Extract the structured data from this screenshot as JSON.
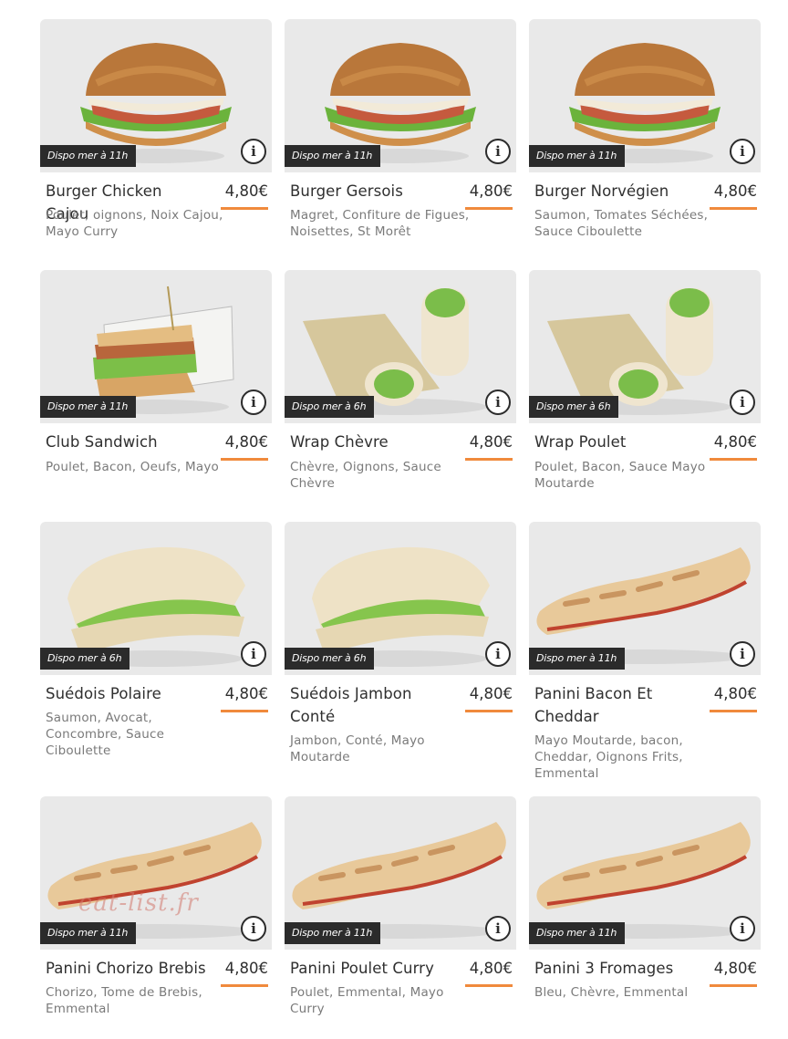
{
  "products": [
    {
      "name": "Burger Chicken Cajou",
      "price": "4,80€",
      "availability": "Dispo mer à 11h",
      "description": "Poulet, oignons, Noix Cajou, Mayo Curry",
      "image": "burger-image"
    },
    {
      "name": "Burger Gersois",
      "price": "4,80€",
      "availability": "Dispo mer à 11h",
      "description": "Magret, Confiture de Figues, Noisettes, St Morêt",
      "image": "burger-image"
    },
    {
      "name": "Burger Norvégien",
      "price": "4,80€",
      "availability": "Dispo mer à 11h",
      "description": "Saumon, Tomates Séchées, Sauce Ciboulette",
      "image": "burger-image"
    },
    {
      "name": "Club Sandwich",
      "price": "4,80€",
      "availability": "Dispo mer à 11h",
      "description": "Poulet, Bacon, Oeufs, Mayo",
      "image": "club-sandwich-image"
    },
    {
      "name": "Wrap Chèvre",
      "price": "4,80€",
      "availability": "Dispo mer à 6h",
      "description": "Chèvre, Oignons, Sauce Chèvre",
      "image": "wrap-image"
    },
    {
      "name": "Wrap Poulet",
      "price": "4,80€",
      "availability": "Dispo mer à 6h",
      "description": "Poulet, Bacon, Sauce Mayo Moutarde",
      "image": "wrap-image"
    },
    {
      "name": "Suédois Polaire",
      "price": "4,80€",
      "availability": "Dispo mer à 6h",
      "description": "Saumon, Avocat, Concombre, Sauce Ciboulette",
      "image": "pita-image"
    },
    {
      "name": "Suédois Jambon Conté",
      "price": "4,80€",
      "availability": "Dispo mer à 6h",
      "description": "Jambon, Conté, Mayo Moutarde",
      "image": "pita-image"
    },
    {
      "name": "Panini Bacon Et Cheddar",
      "price": "4,80€",
      "availability": "Dispo mer à 11h",
      "description": "Mayo Moutarde, bacon, Cheddar, Oignons Frits, Emmental",
      "image": "panini-image"
    },
    {
      "name": "Panini Chorizo Brebis",
      "price": "4,80€",
      "availability": "Dispo mer à 11h",
      "description": "Chorizo, Tome de Brebis, Emmental",
      "image": "panini-image"
    },
    {
      "name": "Panini Poulet Curry",
      "price": "4,80€",
      "availability": "Dispo mer à 11h",
      "description": "Poulet, Emmental, Mayo Curry",
      "image": "panini-image"
    },
    {
      "name": "Panini 3 Fromages",
      "price": "4,80€",
      "availability": "Dispo mer à 11h",
      "description": "Bleu, Chèvre, Emmental",
      "image": "panini-image"
    }
  ],
  "info_button_glyph": "i",
  "watermark": "eat-list.fr",
  "colors": {
    "accent": "#f08a3c",
    "badge": "#2b2b2b",
    "photo_bg": "#e9e9e9",
    "text": "#2f2f2f",
    "muted": "#7a7a7a"
  }
}
